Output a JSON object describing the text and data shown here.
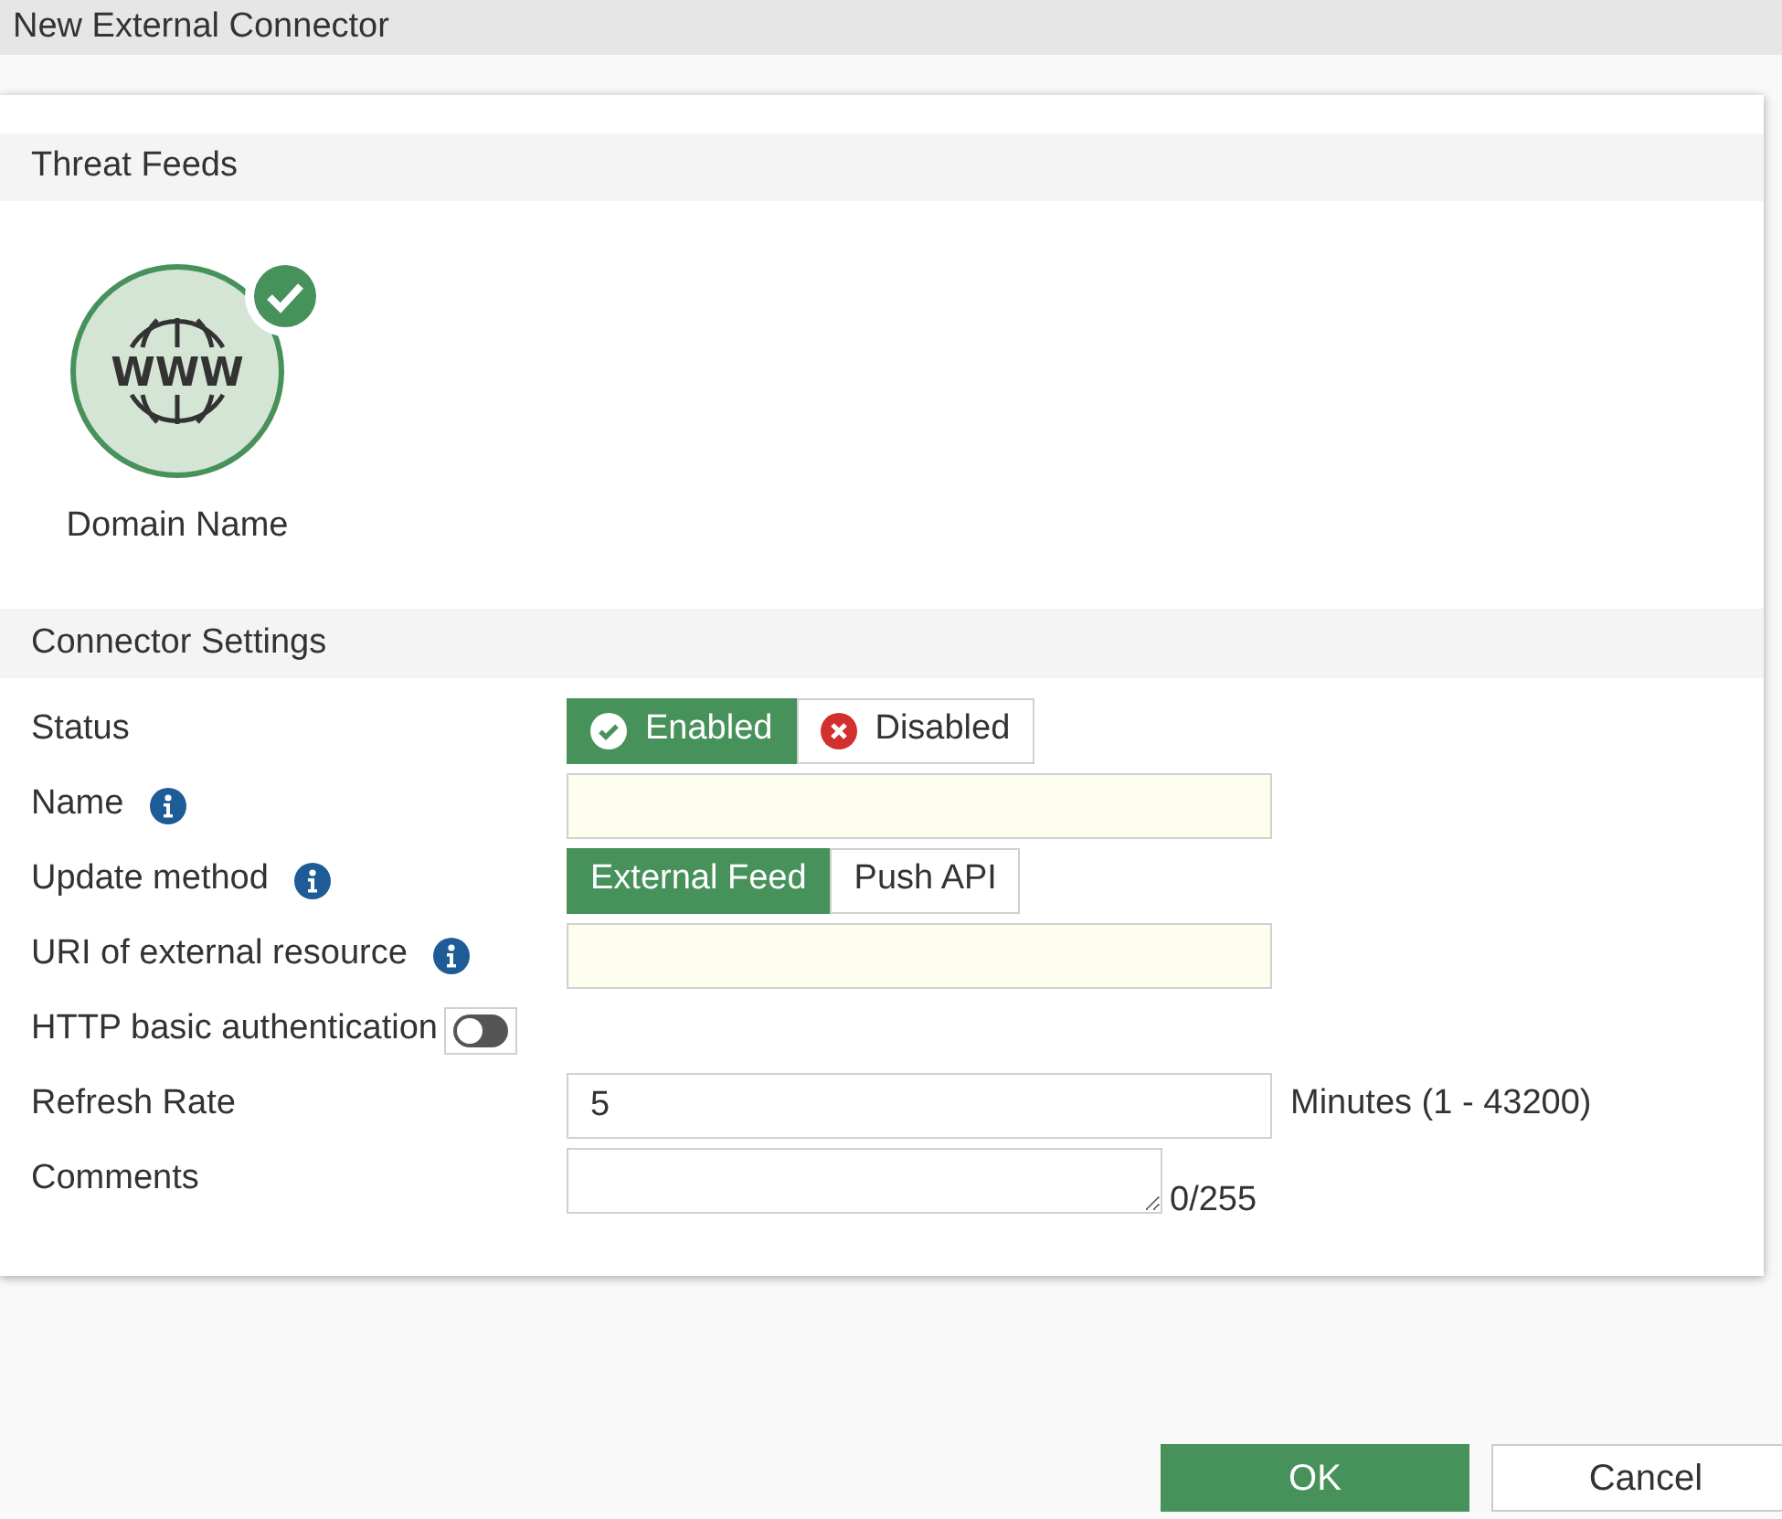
{
  "window": {
    "title": "New External Connector"
  },
  "threat_feeds": {
    "header": "Threat Feeds",
    "items": [
      {
        "label": "Domain Name",
        "icon_text": "WWW",
        "selected": true
      }
    ]
  },
  "connector_settings": {
    "header": "Connector Settings",
    "rows": [
      {
        "kind": "segmented",
        "label": "Status",
        "info": false,
        "options": [
          {
            "label": "Enabled",
            "kind": "enabled",
            "selected": true
          },
          {
            "label": "Disabled",
            "kind": "disabled",
            "selected": false
          }
        ]
      },
      {
        "kind": "input",
        "label": "Name",
        "info": true,
        "required": true,
        "value": ""
      },
      {
        "kind": "segmented",
        "label": "Update method",
        "info": true,
        "options": [
          {
            "label": "External Feed",
            "kind": "plain",
            "selected": true
          },
          {
            "label": "Push API",
            "kind": "plain",
            "selected": false
          }
        ]
      },
      {
        "kind": "input",
        "label": "URI of external resource",
        "info": true,
        "required": true,
        "value": ""
      },
      {
        "kind": "switch",
        "label": "HTTP basic authentication",
        "info": false,
        "on": false
      },
      {
        "kind": "input",
        "label": "Refresh Rate",
        "info": false,
        "required": false,
        "value": "5",
        "suffix": "Minutes (1 - 43200)"
      },
      {
        "kind": "textarea",
        "label": "Comments",
        "info": false,
        "value": "",
        "counter": "0/255"
      }
    ]
  },
  "buttons": [
    {
      "label": "OK",
      "primary": true
    },
    {
      "label": "Cancel",
      "primary": false
    }
  ]
}
